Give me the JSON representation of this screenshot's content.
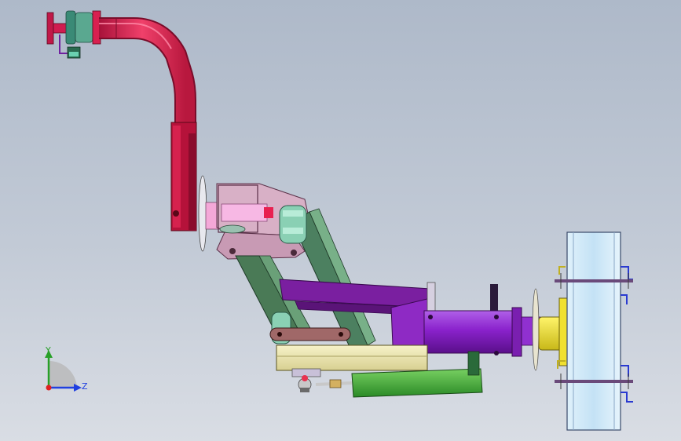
{
  "triad": {
    "y_label": "Y",
    "z_label": "Z"
  },
  "colors": {
    "background_top": "#aeb9c9",
    "background_bottom": "#d9dde4",
    "arm_pipe": "#e0204a",
    "mount_bracket": "#c9a0b8",
    "linkage_arms": "#4c7a5c",
    "purple_frame": "#7a1fa0",
    "cylinder": "#9a2fd6",
    "flange_yellow": "#f0e030",
    "cutter_drum": "#cfe8f8",
    "hydraulic_cylinder": "#3fae38",
    "slide_block": "#efe9b0",
    "axis_y": "#28a028",
    "axis_z": "#2040e0"
  },
  "icons": [
    "coordinate-triad-icon"
  ]
}
